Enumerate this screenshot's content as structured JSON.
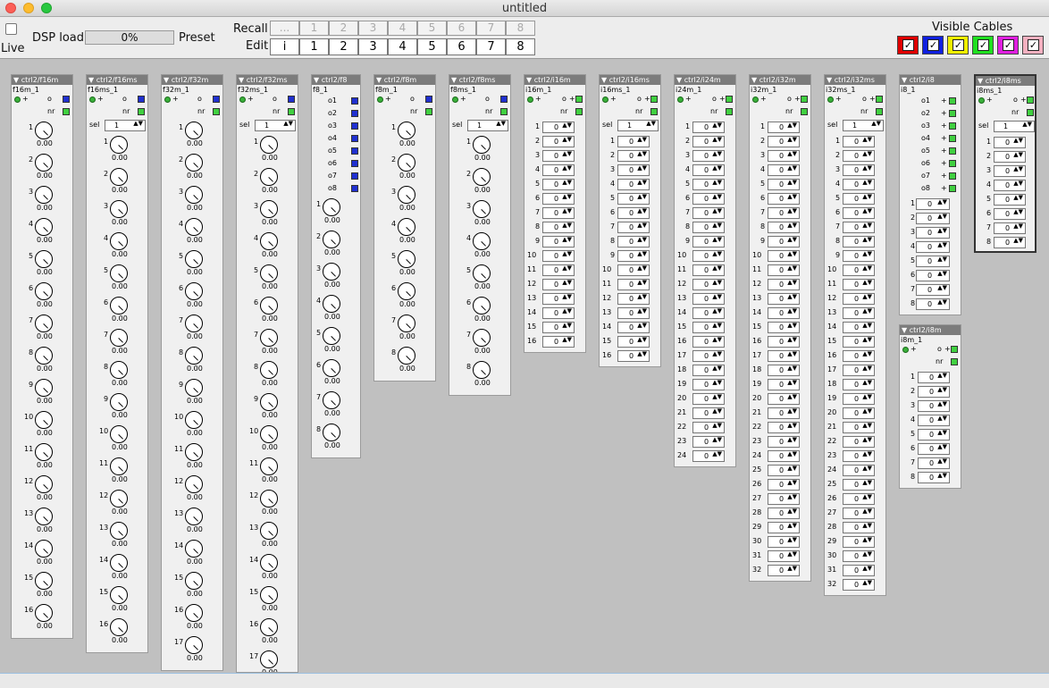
{
  "window": {
    "title": "untitled"
  },
  "toolbar": {
    "live_label": "Live",
    "dsp_label": "DSP load",
    "dsp_value": "0%",
    "dsp_fraction": 0.0,
    "preset_label": "Preset",
    "recall_label": "Recall",
    "edit_label": "Edit",
    "recall_cells": [
      "...",
      "1",
      "2",
      "3",
      "4",
      "5",
      "6",
      "7",
      "8"
    ],
    "edit_cells": [
      "i",
      "1",
      "2",
      "3",
      "4",
      "5",
      "6",
      "7",
      "8"
    ],
    "visible_cables_label": "Visible Cables",
    "cable_colors": [
      "#e00000",
      "#1020e0",
      "#f0f000",
      "#20e020",
      "#e020e0",
      "#f4b0c0"
    ],
    "checkmark": "✓"
  },
  "modules": [
    {
      "header": "ctrl2/f16m",
      "name": "f16m_1",
      "kind": "knob",
      "n": 16,
      "sel": false,
      "nr": true,
      "val": "0.00"
    },
    {
      "header": "ctrl2/f16ms",
      "name": "f16ms_1",
      "kind": "knob",
      "n": 16,
      "sel": true,
      "selval": "1",
      "nr": true,
      "val": "0.00"
    },
    {
      "header": "ctrl2/f32m",
      "name": "f32m_1",
      "kind": "knob",
      "n": 17,
      "sel": false,
      "nr": true,
      "val": "0.00"
    },
    {
      "header": "ctrl2/f32ms",
      "name": "f32ms_1",
      "kind": "knob",
      "n": 17,
      "sel": true,
      "selval": "1",
      "nr": true,
      "val": "0.00"
    },
    {
      "header": "ctrl2/f8",
      "name": "f8_1",
      "kind": "knob8out",
      "n": 8,
      "outs": [
        "o1",
        "o2",
        "o3",
        "o4",
        "o5",
        "o6",
        "o7",
        "o8"
      ],
      "val": "0.00"
    },
    {
      "header": "ctrl2/f8m",
      "name": "f8m_1",
      "kind": "knob",
      "n": 8,
      "sel": false,
      "nr": true,
      "val": "0.00"
    },
    {
      "header": "ctrl2/f8ms",
      "name": "f8ms_1",
      "kind": "knob",
      "n": 8,
      "sel": true,
      "selval": "1",
      "nr": true,
      "val": "0.00"
    },
    {
      "header": "ctrl2/i16m",
      "name": "i16m_1",
      "kind": "int",
      "n": 16,
      "sel": false,
      "nr": true,
      "val": "0"
    },
    {
      "header": "ctrl2/i16ms",
      "name": "i16ms_1",
      "kind": "int",
      "n": 16,
      "sel": true,
      "selval": "1",
      "nr": true,
      "val": "0"
    },
    {
      "header": "ctrl2/i24m",
      "name": "i24m_1",
      "kind": "int",
      "n": 24,
      "sel": false,
      "nr": true,
      "val": "0"
    },
    {
      "header": "ctrl2/i32m",
      "name": "i32m_1",
      "kind": "int",
      "n": 32,
      "sel": false,
      "nr": true,
      "val": "0"
    },
    {
      "header": "ctrl2/i32ms",
      "name": "i32ms_1",
      "kind": "int",
      "n": 32,
      "sel": true,
      "selval": "1",
      "nr": true,
      "val": "0"
    },
    {
      "header": "ctrl2/i8",
      "name": "i8_1",
      "kind": "int8out",
      "n": 8,
      "outs": [
        "o1",
        "o2",
        "o3",
        "o4",
        "o5",
        "o6",
        "o7",
        "o8"
      ],
      "val": "0"
    },
    {
      "header": "ctrl2/i8ms",
      "name": "i8ms_1",
      "kind": "int",
      "n": 8,
      "sel": true,
      "selval": "1",
      "nr": true,
      "val": "0",
      "selected": true
    },
    {
      "header": "ctrl2/i8m",
      "name": "i8m_1",
      "kind": "int",
      "n": 8,
      "sel": false,
      "nr": true,
      "val": "0"
    }
  ],
  "labels": {
    "o": "o",
    "nr": "nr",
    "sel": "sel",
    "plus": "+"
  }
}
